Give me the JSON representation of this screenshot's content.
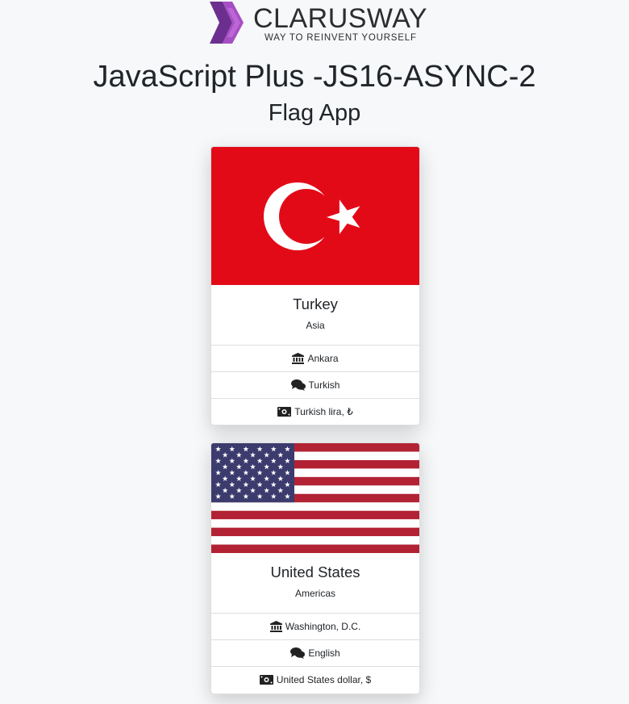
{
  "brand": {
    "name": "CLARUSWAY",
    "tagline": "WAY TO REINVENT YOURSELF"
  },
  "header": {
    "title": "JavaScript Plus -JS16-ASYNC-2",
    "subtitle": "Flag App"
  },
  "countries": [
    {
      "name": "Turkey",
      "region": "Asia",
      "capital": "Ankara",
      "language": "Turkish",
      "currency": "Turkish lira, ₺",
      "flag_icon": "turkey-flag"
    },
    {
      "name": "United States",
      "region": "Americas",
      "capital": "Washington, D.C.",
      "language": "English",
      "currency": "United States dollar, $",
      "flag_icon": "usa-flag"
    }
  ],
  "icons": {
    "capital": "landmark-icon",
    "language": "comments-icon",
    "currency": "money-bill-icon"
  },
  "colors": {
    "turkey_red": "#e30a17",
    "usa_red": "#b22234",
    "usa_blue": "#3c3b6e",
    "logo_purple": "#7b3fa0"
  }
}
